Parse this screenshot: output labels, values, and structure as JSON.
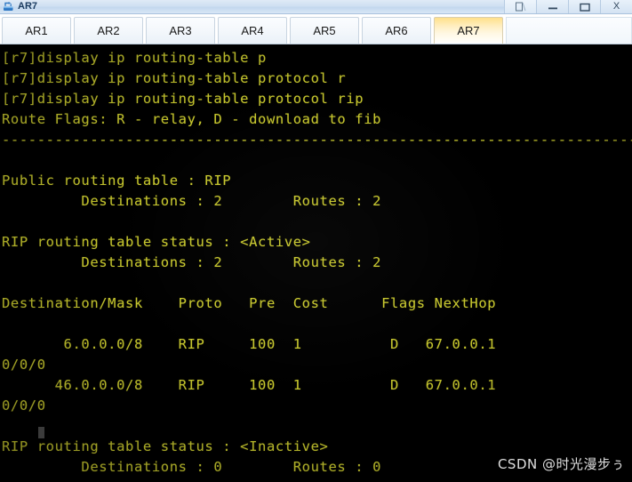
{
  "window": {
    "title": "AR7",
    "icon": "router-icon",
    "buttons": [
      {
        "name": "restore-down-button",
        "glyph": "restore"
      },
      {
        "name": "minimize-button",
        "glyph": "minimize"
      },
      {
        "name": "maximize-button",
        "glyph": "maximize"
      },
      {
        "name": "close-button",
        "glyph": "close",
        "label": "X"
      }
    ]
  },
  "tabs": {
    "items": [
      {
        "label": "AR1",
        "active": false
      },
      {
        "label": "AR2",
        "active": false
      },
      {
        "label": "AR3",
        "active": false
      },
      {
        "label": "AR4",
        "active": false
      },
      {
        "label": "AR5",
        "active": false
      },
      {
        "label": "AR6",
        "active": false
      },
      {
        "label": "AR7",
        "active": true
      }
    ],
    "active_label": "AR7"
  },
  "terminal": {
    "foreground_color": "#c6c62e",
    "background_color": "#000000",
    "prompt": "[r7]",
    "cursor_visible": true,
    "lines": [
      "[r7]display ip routing-table p",
      "[r7]display ip routing-table protocol r",
      "[r7]display ip routing-table protocol rip",
      "Route Flags: R - relay, D - download to fib",
      "------------------------------------------------------------------------------",
      "",
      "Public routing table : RIP",
      "         Destinations : 2        Routes : 2",
      "",
      "RIP routing table status : <Active>",
      "         Destinations : 2        Routes : 2",
      "",
      "Destination/Mask    Proto   Pre  Cost      Flags NextHop",
      "",
      "       6.0.0.0/8    RIP     100  1          D   67.0.0.1",
      "0/0/0",
      "      46.0.0.0/8    RIP     100  1          D   67.0.0.1",
      "0/0/0",
      "",
      "RIP routing table status : <Inactive>",
      "         Destinations : 0        Routes : 0"
    ]
  },
  "routing_table": {
    "headers": [
      "Destination/Mask",
      "Proto",
      "Pre",
      "Cost",
      "Flags",
      "NextHop"
    ],
    "rows": [
      {
        "destination_mask": "6.0.0.0/8",
        "proto": "RIP",
        "pre": "100",
        "cost": "1",
        "flags": "D",
        "next_hop": "67.0.0.1",
        "interface": "0/0/0"
      },
      {
        "destination_mask": "46.0.0.0/8",
        "proto": "RIP",
        "pre": "100",
        "cost": "1",
        "flags": "D",
        "next_hop": "67.0.0.1",
        "interface": "0/0/0"
      }
    ],
    "public_table": {
      "name": "Public routing table : RIP",
      "destinations": "2",
      "routes": "2"
    },
    "active_status": {
      "label": "RIP routing table status : <Active>",
      "destinations": "2",
      "routes": "2"
    },
    "inactive_status": {
      "label": "RIP routing table status : <Inactive>",
      "destinations": "0",
      "routes": "0"
    },
    "route_flags_legend": "Route Flags: R - relay, D - download to fib"
  },
  "watermark": {
    "text": "CSDN @时光漫步ぅ"
  }
}
